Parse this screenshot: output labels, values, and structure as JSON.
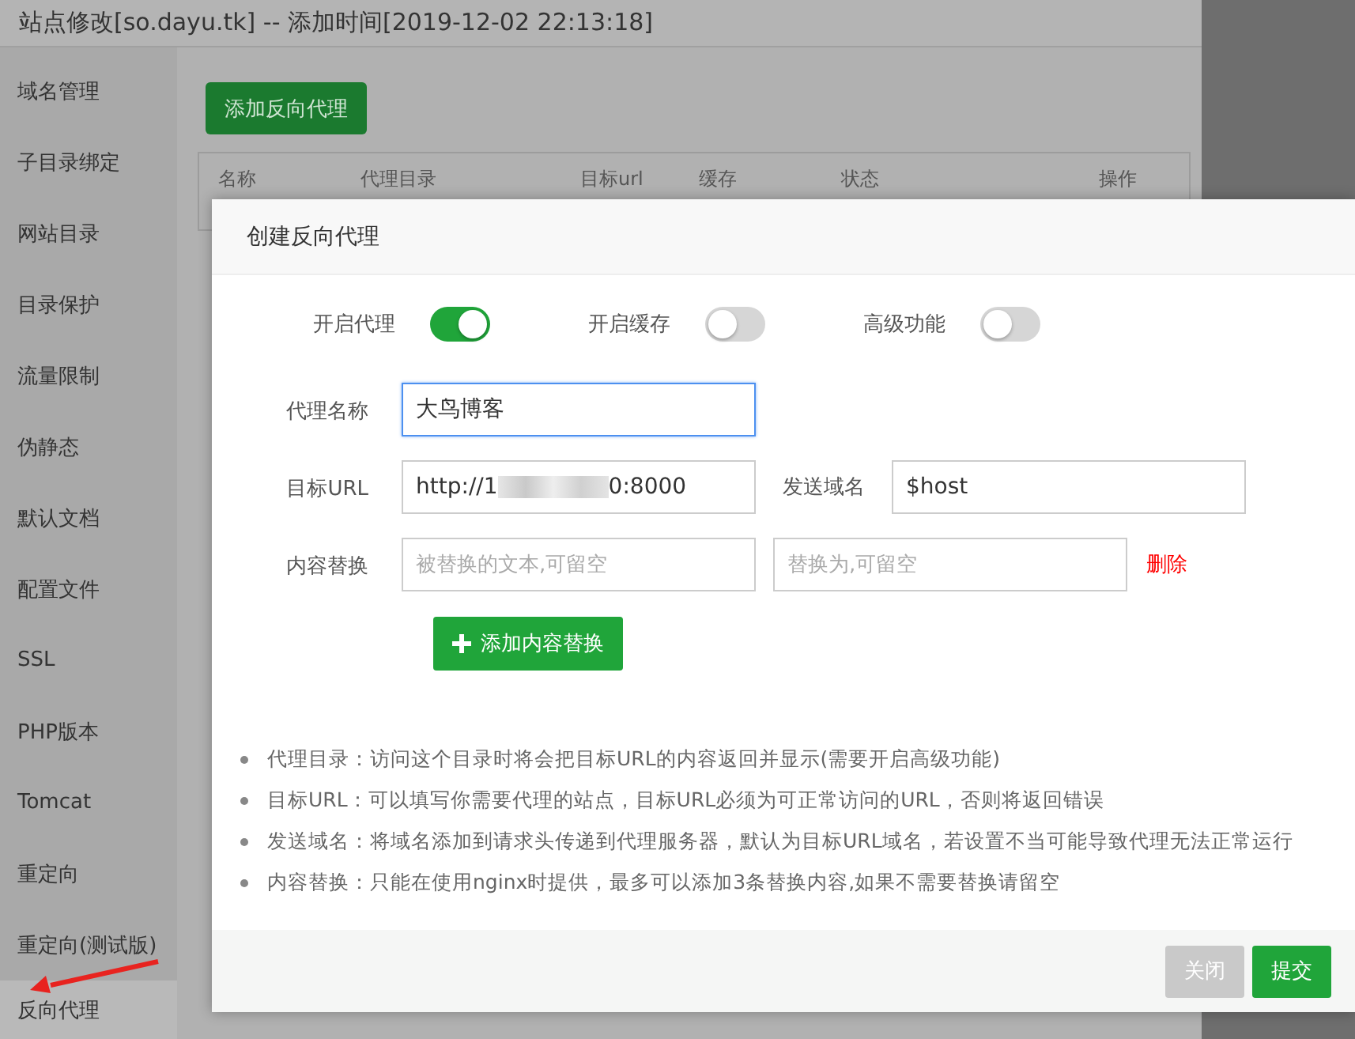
{
  "window": {
    "title": "站点修改[so.dayu.tk] -- 添加时间[2019-12-02 22:13:18]"
  },
  "sidebar": {
    "items": [
      {
        "label": "域名管理",
        "selected": false
      },
      {
        "label": "子目录绑定",
        "selected": false
      },
      {
        "label": "网站目录",
        "selected": false
      },
      {
        "label": "目录保护",
        "selected": false
      },
      {
        "label": "流量限制",
        "selected": false
      },
      {
        "label": "伪静态",
        "selected": false
      },
      {
        "label": "默认文档",
        "selected": false
      },
      {
        "label": "配置文件",
        "selected": false
      },
      {
        "label": "SSL",
        "selected": false
      },
      {
        "label": "PHP版本",
        "selected": false
      },
      {
        "label": "Tomcat",
        "selected": false
      },
      {
        "label": "重定向",
        "selected": false
      },
      {
        "label": "重定向(测试版)",
        "selected": false
      },
      {
        "label": "反向代理",
        "selected": true
      }
    ]
  },
  "toolbar": {
    "add_button": "添加反向代理"
  },
  "table": {
    "columns": [
      "名称",
      "代理目录",
      "目标url",
      "缓存",
      "状态",
      "操作"
    ]
  },
  "dialog": {
    "title": "创建反向代理",
    "switches": [
      {
        "label": "开启代理",
        "on": true
      },
      {
        "label": "开启缓存",
        "on": false
      },
      {
        "label": "高级功能",
        "on": false
      }
    ],
    "name_field": {
      "label": "代理名称",
      "value": "大鸟博客",
      "focused": true
    },
    "target_url": {
      "label": "目标URL",
      "value_start": "http://1",
      "value_end": "0:8000",
      "redacted": true
    },
    "send_domain": {
      "label": "发送域名",
      "value": "$host"
    },
    "replace": {
      "label": "内容替换",
      "placeholders": [
        "被替换的文本,可留空",
        "替换为,可留空"
      ],
      "delete": "删除"
    },
    "add_replace_button": "添加内容替换",
    "notes": [
      "代理目录：访问这个目录时将会把目标URL的内容返回并显示(需要开启高级功能)",
      "目标URL：可以填写你需要代理的站点，目标URL必须为可正常访问的URL，否则将返回错误",
      "发送域名：将域名添加到请求头传递到代理服务器，默认为目标URL域名，若设置不当可能导致代理无法正常运行",
      "内容替换：只能在使用nginx时提供，最多可以添加3条替换内容,如果不需要替换请留空"
    ],
    "buttons": [
      {
        "label": "关闭",
        "kind": "close"
      },
      {
        "label": "提交",
        "kind": "submit"
      }
    ]
  }
}
